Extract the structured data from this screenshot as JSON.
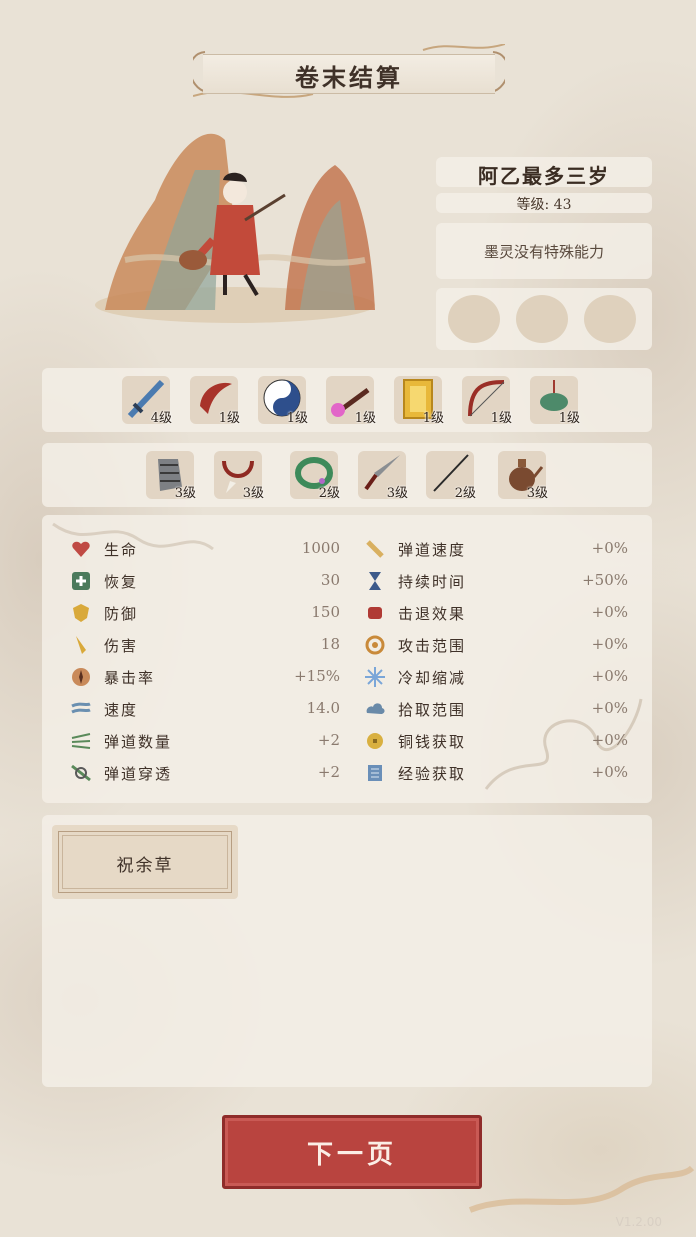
{
  "title": "卷末结算",
  "character": {
    "name": "阿乙最多三岁",
    "level_text": "等级: 43",
    "ability": "墨灵没有特殊能力"
  },
  "items_row1": [
    {
      "icon": "sword-icon",
      "level": "4级"
    },
    {
      "icon": "crescent-blade-icon",
      "level": "1级"
    },
    {
      "icon": "yin-yang-icon",
      "level": "1级"
    },
    {
      "icon": "fire-brush-icon",
      "level": "1级"
    },
    {
      "icon": "golden-door-icon",
      "level": "1级"
    },
    {
      "icon": "bow-icon",
      "level": "1级"
    },
    {
      "icon": "jade-pendant-icon",
      "level": "1级"
    }
  ],
  "items_row2": [
    {
      "icon": "armor-gauntlet-icon",
      "level": "3级"
    },
    {
      "icon": "fang-necklace-icon",
      "level": "3级"
    },
    {
      "icon": "jade-bracelet-icon",
      "level": "2级"
    },
    {
      "icon": "dagger-icon",
      "level": "3级"
    },
    {
      "icon": "needle-icon",
      "level": "2级"
    },
    {
      "icon": "teapot-icon",
      "level": "3级"
    }
  ],
  "stats_left": [
    {
      "icon": "heart-icon",
      "label": "生命",
      "value": "1000"
    },
    {
      "icon": "heal-cross-icon",
      "label": "恢复",
      "value": "30"
    },
    {
      "icon": "shield-icon",
      "label": "防御",
      "value": "150"
    },
    {
      "icon": "blade-icon",
      "label": "伤害",
      "value": "18"
    },
    {
      "icon": "crit-star-icon",
      "label": "暴击率",
      "value": "+15%"
    },
    {
      "icon": "wind-icon",
      "label": "速度",
      "value": "14.0"
    },
    {
      "icon": "arrows-icon",
      "label": "弹道数量",
      "value": "+2"
    },
    {
      "icon": "pierce-icon",
      "label": "弹道穿透",
      "value": "+2"
    }
  ],
  "stats_right": [
    {
      "icon": "projectile-speed-icon",
      "label": "弹道速度",
      "value": "+0%"
    },
    {
      "icon": "hourglass-icon",
      "label": "持续时间",
      "value": "+50%"
    },
    {
      "icon": "fist-icon",
      "label": "击退效果",
      "value": "+0%"
    },
    {
      "icon": "spiral-icon",
      "label": "攻击范围",
      "value": "+0%"
    },
    {
      "icon": "snowflake-icon",
      "label": "冷却缩减",
      "value": "+0%"
    },
    {
      "icon": "cloud-icon",
      "label": "拾取范围",
      "value": "+0%"
    },
    {
      "icon": "coin-icon",
      "label": "铜钱获取",
      "value": "+0%"
    },
    {
      "icon": "scroll-icon",
      "label": "经验获取",
      "value": "+0%"
    }
  ],
  "blessing": {
    "label": "祝余草"
  },
  "next_button": "下一页",
  "version": "V1.2.00",
  "colors": {
    "accent_red": "#b9443f",
    "panel": "#f3eee6",
    "text": "#3f3128"
  }
}
